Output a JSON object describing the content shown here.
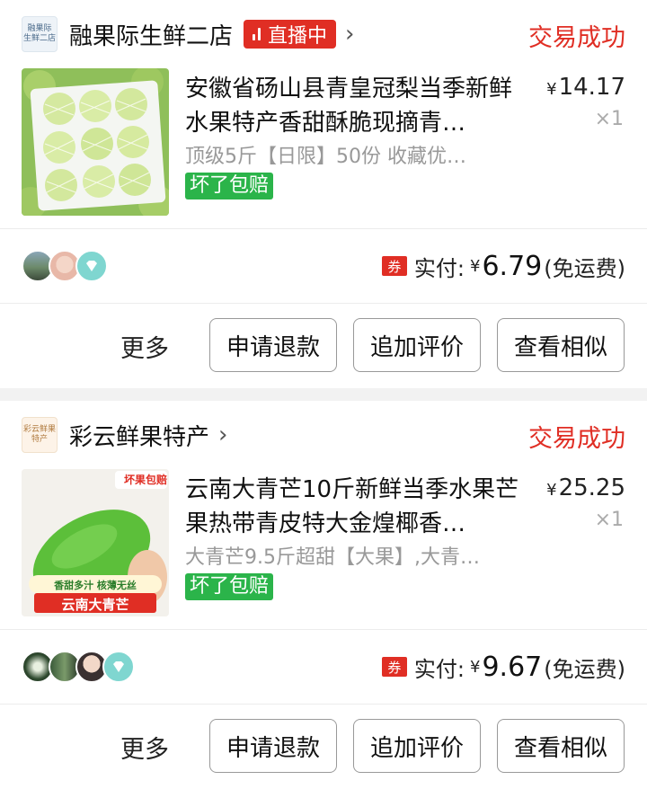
{
  "orders": [
    {
      "shop": {
        "name": "融果际生鲜二店",
        "logo_text": "融果际\n生鲜二店",
        "live_label": "直播中"
      },
      "status": "交易成功",
      "product": {
        "title": "安徽省砀山县青皇冠梨当季新鲜水果特产香甜酥脆现摘青…",
        "price_symbol": "¥",
        "price": "14.17",
        "qty": "×1",
        "spec": "顶级5斤【日限】50份 收藏优…",
        "tag": "坏了包赔",
        "image_icon": "green-pear-box-photo"
      },
      "payment": {
        "coupon": "券",
        "label": "实付:",
        "currency": "¥",
        "amount": "6.79",
        "note": "(免运费)"
      },
      "actions": {
        "more": "更多",
        "refund": "申请退款",
        "review": "追加评价",
        "similar": "查看相似"
      }
    },
    {
      "shop": {
        "name": "彩云鲜果特产",
        "logo_text": "彩云鲜果\n特产"
      },
      "status": "交易成功",
      "product": {
        "title": "云南大青芒10斤新鲜当季水果芒果热带青皮特大金煌椰香…",
        "price_symbol": "¥",
        "price": "25.25",
        "qty": "×1",
        "spec": "大青芒9.5斤超甜【大果】,大青…",
        "tag": "坏了包赔",
        "image_icon": "green-mango-photo",
        "image_texts": {
          "corner": "坏果包赔",
          "sub": "香甜多汁 核薄无丝",
          "main": "云南大青芒"
        }
      },
      "payment": {
        "coupon": "券",
        "label": "实付:",
        "currency": "¥",
        "amount": "9.67",
        "note": "(免运费)"
      },
      "actions": {
        "more": "更多",
        "refund": "申请退款",
        "review": "追加评价",
        "similar": "查看相似"
      }
    }
  ],
  "colors": {
    "accent": "#e02e24",
    "tag_green": "#2bb44a",
    "avatar_teal": "#7fd6d0"
  }
}
